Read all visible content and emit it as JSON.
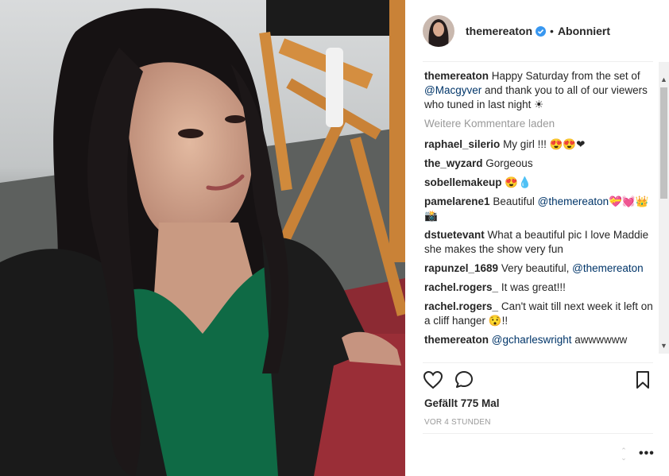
{
  "header": {
    "username": "themereaton",
    "dot": "•",
    "follow_status": "Abonniert"
  },
  "caption": {
    "username": "themereaton",
    "text_before": " Happy Saturday from the set of ",
    "mention": "@Macgyver",
    "text_after": " and thank you to all of our viewers who tuned in last night ☀"
  },
  "load_more": "Weitere Kommentare laden",
  "comments": [
    {
      "username": "raphael_silerio",
      "text": " My girl !!! 😍😍❤"
    },
    {
      "username": "the_wyzard",
      "text": " Gorgeous"
    },
    {
      "username": "sobellemakeup",
      "text": " 😍💧"
    },
    {
      "username": "pamelarene1",
      "text": " Beautiful ",
      "mention": "@themereaton",
      "text_after": "💝💓👑📸"
    },
    {
      "username": "dstuetevant",
      "text": " What a beautiful pic I love Maddie she makes the show very fun"
    },
    {
      "username": "rapunzel_1689",
      "text": " Very beautiful, ",
      "mention": "@themereaton",
      "text_after": ""
    },
    {
      "username": "rachel.rogers_",
      "text": "  It was great!!!"
    },
    {
      "username": "rachel.rogers_",
      "text": "  Can't wait till next week it left on a cliff hanger 😯!!"
    },
    {
      "username": "themereaton",
      "text": " ",
      "mention": "@gcharleswright",
      "text_after": " awwwwww"
    }
  ],
  "likes": "Gefällt 775 Mal",
  "timestamp": "VOR 4 STUNDEN",
  "icons": {
    "like": "heart-icon",
    "comment": "comment-icon",
    "save": "bookmark-icon",
    "more": "more-options-icon",
    "verified": "verified-badge-icon"
  },
  "colors": {
    "text": "#262626",
    "link": "#003569",
    "muted": "#999999",
    "verified": "#3897f0"
  }
}
